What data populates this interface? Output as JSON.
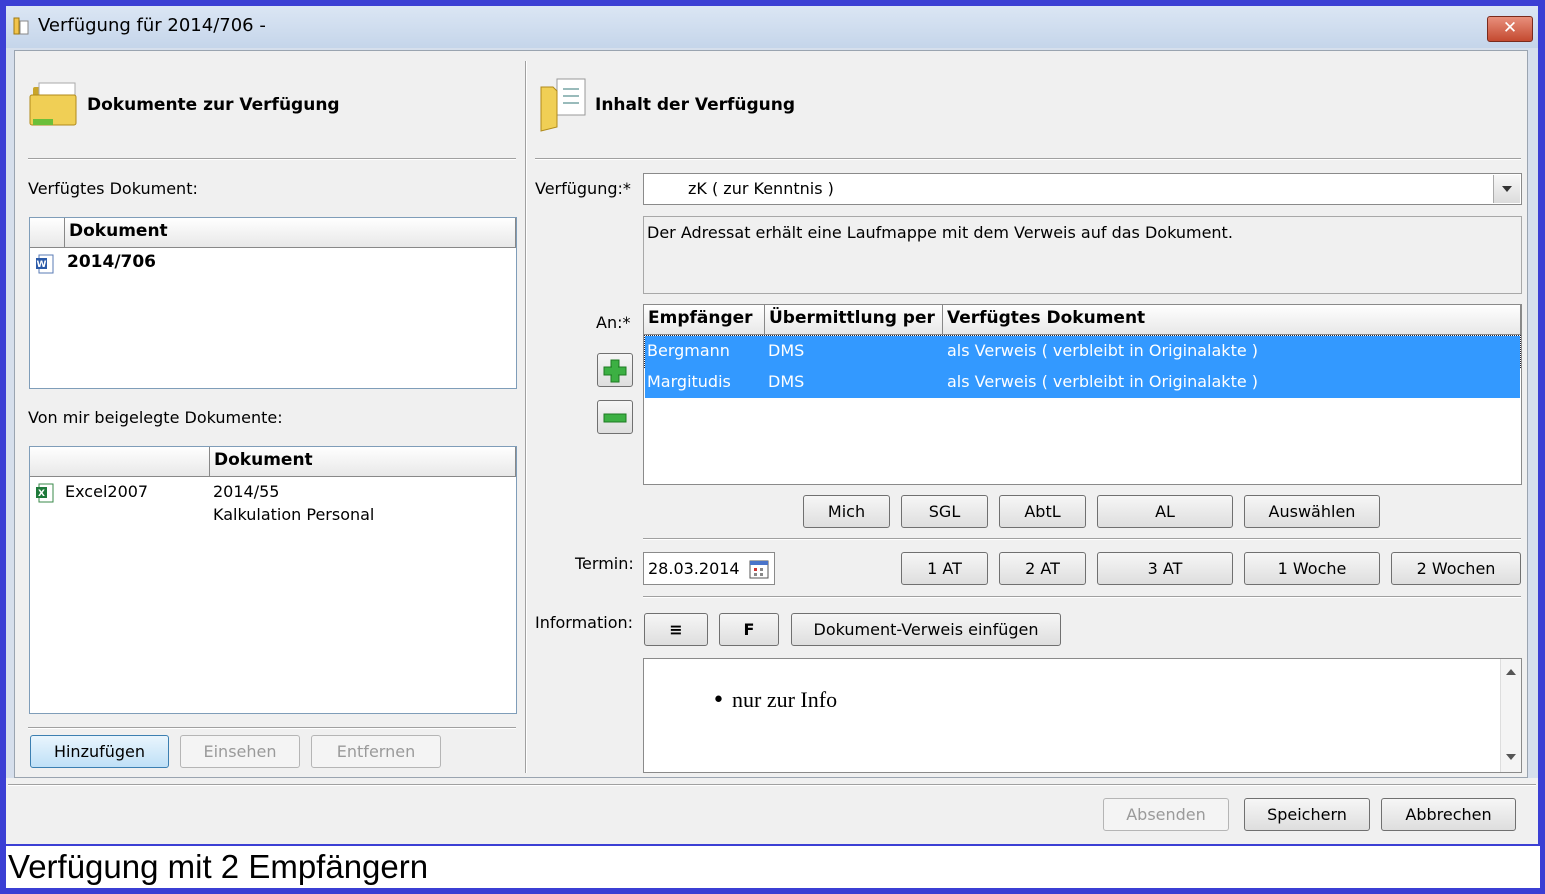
{
  "window": {
    "title": "Verfügung für 2014/706 -",
    "close_label": "✕"
  },
  "left": {
    "header": "Dokumente zur Verfügung",
    "verfuegtes_label": "Verfügtes Dokument:",
    "verfuegtes_table": {
      "column": "Dokument",
      "rows": [
        {
          "doc": "2014/706"
        }
      ]
    },
    "beigelegt_label": "Von mir beigelegte Dokumente:",
    "beigelegt_table": {
      "column": "Dokument",
      "rows": [
        {
          "name": "Excel2007",
          "doc": "2014/55",
          "desc": "Kalkulation Personal"
        }
      ]
    },
    "buttons": {
      "add": "Hinzufügen",
      "view": "Einsehen",
      "remove": "Entfernen"
    }
  },
  "right": {
    "header": "Inhalt der Verfügung",
    "verfuegung_label": "Verfügung:*",
    "verfuegung_value": "zK ( zur Kenntnis )",
    "description": "Der Adressat erhält eine Laufmappe mit dem Verweis auf das Dokument.",
    "an_label": "An:*",
    "recipients": {
      "columns": [
        "Empfänger",
        "Übermittlung per",
        "Verfügtes Dokument"
      ],
      "rows": [
        {
          "name": "Bergmann",
          "via": "DMS",
          "doc": "als Verweis ( verbleibt in Originalakte )"
        },
        {
          "name": "Margitudis",
          "via": "DMS",
          "doc": "als Verweis ( verbleibt in Originalakte )"
        }
      ]
    },
    "recipient_buttons": [
      "Mich",
      "SGL",
      "AbtL",
      "AL",
      "Auswählen"
    ],
    "termin_label": "Termin:",
    "termin_value": "28.03.2014",
    "termin_buttons": [
      "1 AT",
      "2 AT",
      "3 AT",
      "1 Woche",
      "2 Wochen"
    ],
    "information_label": "Information:",
    "format_buttons": {
      "list": "≡",
      "bold": "F",
      "insert": "Dokument-Verweis einfügen"
    },
    "info_text": "nur zur Info"
  },
  "footer": {
    "send": "Absenden",
    "save": "Speichern",
    "cancel": "Abbrechen"
  },
  "caption": "Verfügung mit 2 Empfängern"
}
